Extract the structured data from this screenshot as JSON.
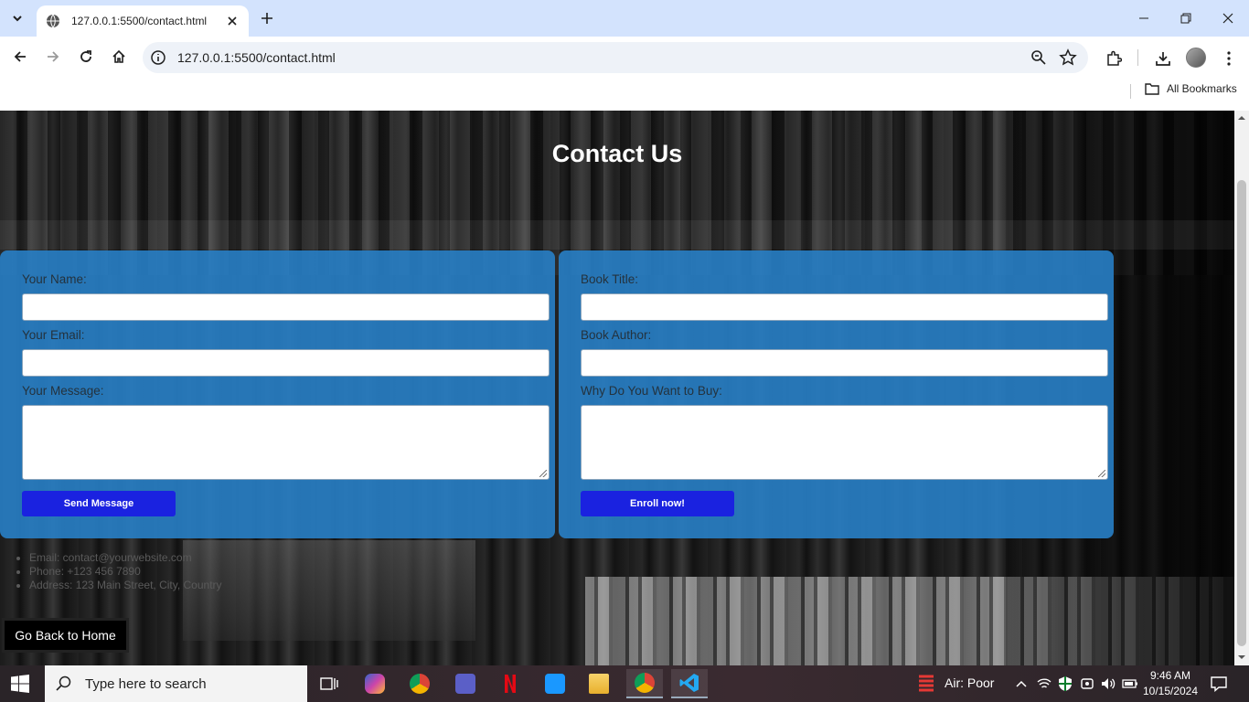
{
  "browser": {
    "tab_title": "127.0.0.1:5500/contact.html",
    "url": "127.0.0.1:5500/contact.html",
    "bookmarks_label": "All Bookmarks"
  },
  "page": {
    "title": "Contact Us",
    "contact_form": {
      "name_label": "Your Name:",
      "email_label": "Your Email:",
      "message_label": "Your Message:",
      "submit_label": "Send Message"
    },
    "book_form": {
      "title_label": "Book Title:",
      "author_label": "Book Author:",
      "reason_label": "Why Do You Want to Buy:",
      "submit_label": "Enroll now!"
    },
    "contact_info": [
      "Email: contact@yourwebsite.com",
      "Phone: +123 456 7890",
      "Address: 123 Main Street, City, Country"
    ],
    "home_button": "Go Back to Home"
  },
  "taskbar": {
    "search_placeholder": "Type here to search",
    "air_quality": "Air: Poor",
    "time": "9:46 AM",
    "date": "10/15/2024"
  }
}
